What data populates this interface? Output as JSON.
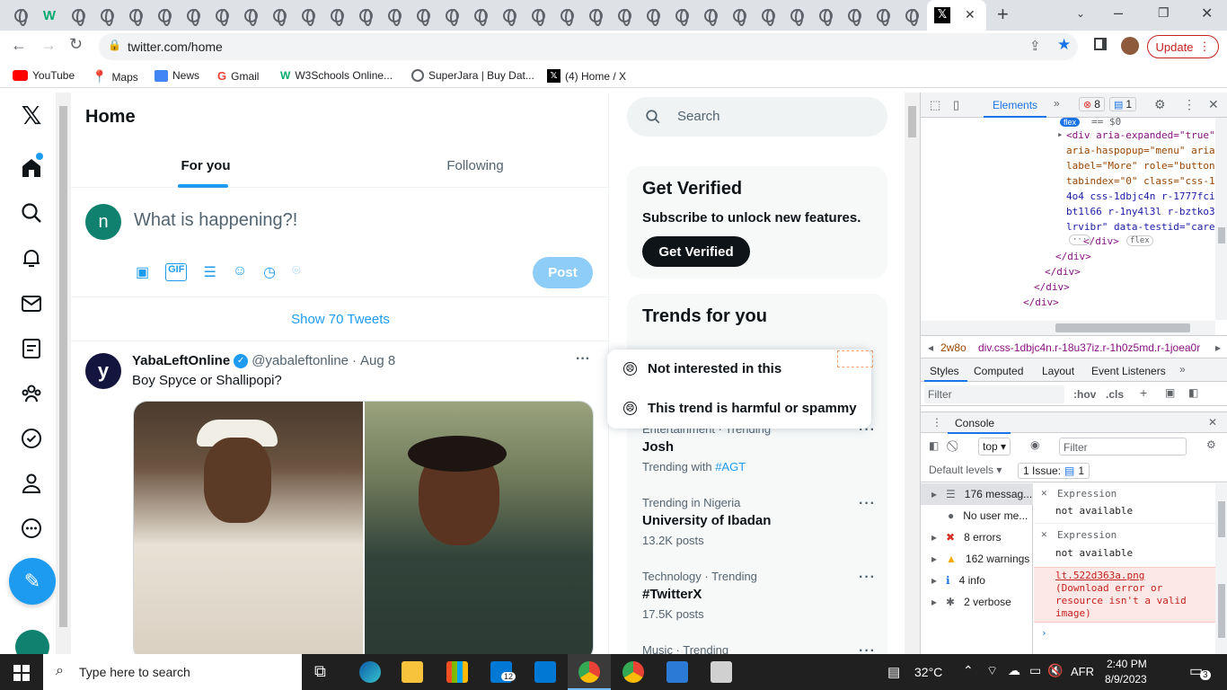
{
  "browser": {
    "active_tab_close": "✕",
    "new_tab": "+",
    "url": "twitter.com/home",
    "update_label": "Update",
    "bookmarks": [
      {
        "label": "YouTube"
      },
      {
        "label": "Maps"
      },
      {
        "label": "News"
      },
      {
        "label": "Gmail"
      },
      {
        "label": "W3Schools Online..."
      },
      {
        "label": "SuperJara | Buy Dat..."
      },
      {
        "label": "(4) Home / X"
      }
    ]
  },
  "twitter": {
    "page_title": "Home",
    "tabs": [
      {
        "label": "For you"
      },
      {
        "label": "Following"
      }
    ],
    "composer": {
      "avatar_letter": "n",
      "placeholder": "What is happening?!",
      "post_label": "Post"
    },
    "show_tweets": "Show 70 Tweets",
    "tweet": {
      "avatar_letter": "y",
      "name": "YabaLeftOnline",
      "handle": "@yabaleftonline",
      "sep": "·",
      "date": "Aug 8",
      "text": "Boy Spyce or Shallipopi?"
    },
    "search_placeholder": "Search",
    "verified": {
      "title": "Get Verified",
      "subtitle": "Subscribe to unlock new features.",
      "button": "Get Verified"
    },
    "trends_title": "Trends for you",
    "popup": [
      {
        "label": "Not interested in this"
      },
      {
        "label": "This trend is harmful or spammy"
      }
    ],
    "trends": [
      {
        "meta": "Entertainment · Trending",
        "name": "Josh",
        "extra_prefix": "Trending with",
        "extra_link": "#AGT"
      },
      {
        "meta": "Trending in Nigeria",
        "name": "University of Ibadan",
        "count": "13.2K posts"
      },
      {
        "meta": "Technology · Trending",
        "name": "#TwitterX",
        "count": "17.5K posts"
      },
      {
        "meta": "Music · Trending"
      }
    ]
  },
  "devtools": {
    "tabs": {
      "elements": "Elements",
      "errors_count": "8",
      "messages_count": "1"
    },
    "code_lines": [
      "<div aria-expanded=\"true\"",
      "aria-haspopup=\"menu\" aria-",
      "label=\"More\" role=\"button\"",
      "tabindex=\"0\" class=\"css-1",
      "4o4 css-1dbjc4n r-1777fci",
      "bt1l66 r-1ny4l3l r-bztko3",
      "lrvibr\" data-testid=\"care",
      "</div>",
      "</div>",
      "</div>",
      "</div>",
      "</div>"
    ],
    "flex_badge": "flex",
    "dollar0": "== $0",
    "breadcrumb_left": "2w8o",
    "breadcrumb_right": "div.css-1dbjc4n.r-18u37iz.r-1h0z5md.r-1joea0r",
    "style_tabs": [
      "Styles",
      "Computed",
      "Layout",
      "Event Listeners"
    ],
    "filter_placeholder": "Filter",
    "hov": ":hov",
    "cls": ".cls",
    "console_title": "Console",
    "top_label": "top",
    "default_levels": "Default levels",
    "issues_label": "1 Issue:",
    "issues_count": "1",
    "sidebar_items": [
      {
        "label": "176 messag..."
      },
      {
        "label": "No user me..."
      },
      {
        "label": "8 errors"
      },
      {
        "label": "162 warnings"
      },
      {
        "label": "4 info"
      },
      {
        "label": "2 verbose"
      }
    ],
    "expressions": [
      {
        "label": "Expression",
        "value": "not available"
      },
      {
        "label": "Expression",
        "value": "not available"
      }
    ],
    "error_link": "lt.522d363a.png",
    "error_text": "(Download error or resource isn't a valid image)"
  },
  "taskbar": {
    "search_placeholder": "Type here to search",
    "mail_badge": "12",
    "weather": "32°C",
    "lang": "AFR",
    "time": "2:40 PM",
    "date": "8/9/2023",
    "notif_count": "3"
  }
}
